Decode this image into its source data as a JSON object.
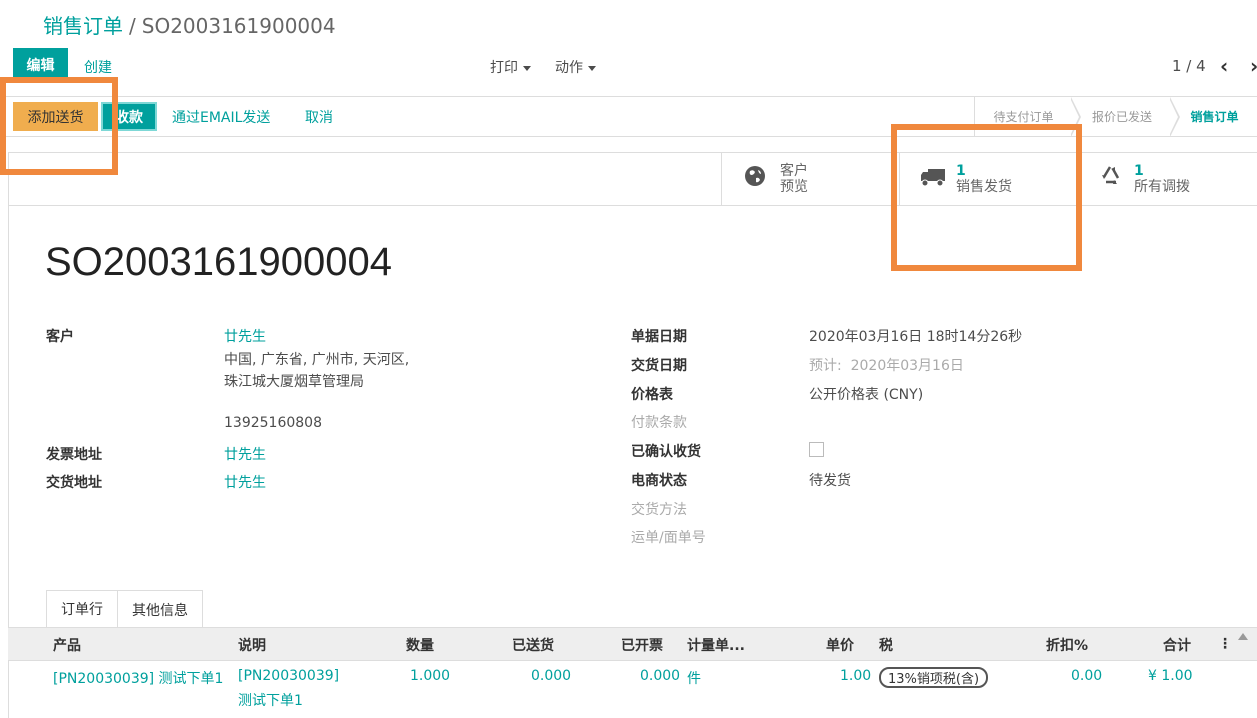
{
  "breadcrumb": {
    "parent": "销售订单",
    "separator": "/",
    "current": "SO2003161900004"
  },
  "control_panel": {
    "edit_label": "编辑",
    "create_label": "创建",
    "print_label": "打印",
    "action_label": "动作",
    "pager_text": "1 / 4",
    "prev_icon": "‹",
    "next_icon": "›"
  },
  "header_buttons": {
    "add_delivery": "添加送货",
    "payment": "收款",
    "send_email": "通过EMAIL发送",
    "cancel": "取消"
  },
  "statusbar": {
    "stages": [
      "待支付订单",
      "报价已发送",
      "销售订单"
    ],
    "active_stage": "销售订单"
  },
  "smart_buttons": {
    "preview": {
      "line1": "客户",
      "line2": "预览",
      "icon": "globe-icon"
    },
    "delivery": {
      "count": "1",
      "label": "销售发货",
      "icon": "truck-icon"
    },
    "transfers": {
      "count": "1",
      "label": "所有调拨",
      "icon": "recycle-icon"
    }
  },
  "order": {
    "name": "SO2003161900004",
    "left": {
      "customer_label": "客户",
      "customer_name": "廿先生",
      "address_line1": "中国, 广东省, 广州市, 天河区,",
      "address_line2": "珠江城大厦烟草管理局",
      "phone": "13925160808",
      "invoice_label": "发票地址",
      "invoice_value": "廿先生",
      "shipping_label": "交货地址",
      "shipping_value": "廿先生"
    },
    "right": {
      "date_label": "单据日期",
      "date_value": "2020年03月16日 18时14分26秒",
      "delivery_date_label": "交货日期",
      "delivery_date_value": "预计:  2020年03月16日",
      "pricelist_label": "价格表",
      "pricelist_value": "公开价格表 (CNY)",
      "payment_terms_label": "付款条款",
      "confirmed_label": "已确认收货",
      "ecom_status_label": "电商状态",
      "ecom_status_value": "待发货",
      "delivery_method_label": "交货方法",
      "tracking_label": "运单/面单号"
    }
  },
  "tabs": [
    "订单行",
    "其他信息"
  ],
  "table": {
    "headers": [
      "产品",
      "说明",
      "数量",
      "已送货",
      "已开票",
      "计量单...",
      "单价",
      "税",
      "折扣%",
      "合计"
    ],
    "rows": [
      {
        "product": "[PN20030039] 测试下单1",
        "desc_line1": "[PN20030039]",
        "desc_line2": "测试下单1",
        "qty": "1.000",
        "delivered": "0.000",
        "invoiced": "0.000",
        "uom": "件",
        "price": "1.00",
        "tax": "13%销项税(含)",
        "discount": "0.00",
        "total": "¥ 1.00"
      }
    ]
  }
}
